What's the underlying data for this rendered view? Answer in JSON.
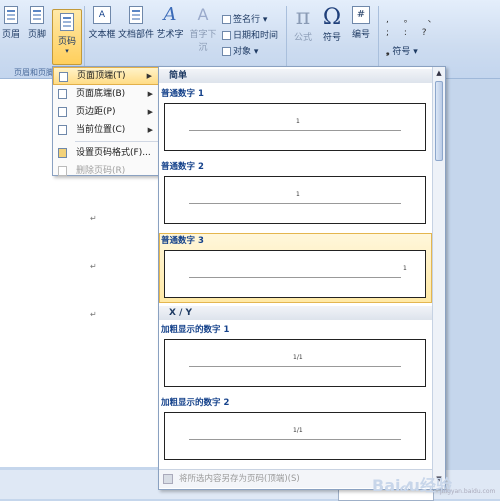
{
  "ribbon": {
    "header_btn": "页眉",
    "footer_btn": "页脚",
    "pagenum_btn": "页码",
    "group_label": "页眉和页脚",
    "textbox_btn": "文本框",
    "quickparts_btn": "文档部件",
    "wordart_btn": "艺术字",
    "dropcap_btn": "首字下沉",
    "signature_line": "签名行",
    "datetime": "日期和时间",
    "object": "对象",
    "equation_btn": "公式",
    "symbol_btn": "符号",
    "number_btn": "编号",
    "special_symbol": "符号",
    "pi_glyph": "π",
    "omega_glyph": "Ω",
    "hash_glyph": "#"
  },
  "menu": {
    "items": [
      {
        "label": "页面顶端(T)",
        "icon": "page-top-icon"
      },
      {
        "label": "页面底端(B)",
        "icon": "page-bottom-icon"
      },
      {
        "label": "页边距(P)",
        "icon": "page-margin-icon"
      },
      {
        "label": "当前位置(C)",
        "icon": "current-position-icon"
      },
      {
        "label": "设置页码格式(F)...",
        "icon": "format-page-number-icon"
      },
      {
        "label": "删除页码(R)",
        "icon": "remove-page-number-icon"
      }
    ]
  },
  "gallery": {
    "section1": "简单",
    "item1": "普通数字 1",
    "item2": "普通数字 2",
    "item3": "普通数字 3",
    "section2": "X / Y",
    "item4": "加粗显示的数字 1",
    "item5": "加粗显示的数字 2",
    "num1": "1",
    "num2": "1",
    "num3": "1",
    "num4": "1/1",
    "num5": "1/1",
    "footer": "将所选内容另存为页码(顶端)(S)"
  },
  "doc": {
    "return_mark": "↵"
  },
  "watermark": {
    "text": "Bai𝒹u经验",
    "sub": "jingyan.baidu.com"
  }
}
